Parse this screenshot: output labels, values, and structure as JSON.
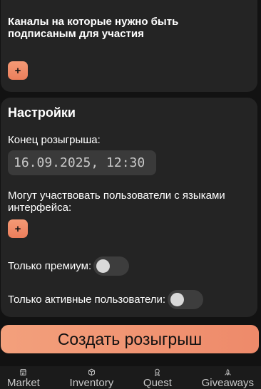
{
  "channels": {
    "title": "Каналы на которые нужно быть подписаным для участия",
    "add_label": "+"
  },
  "settings": {
    "title": "Настройки",
    "end_label": "Конец розыгрыша:",
    "end_value": "16.09.2025, 12:30",
    "lang_label": "Могут участвовать пользователи с языками интерфейса:",
    "lang_add_label": "+",
    "premium_label": "Только премиум:",
    "premium_on": false,
    "active_label": "Только активные пользователи:",
    "active_on": false
  },
  "create_button": "Создать розыгрыш",
  "tabbar": {
    "tabs": [
      {
        "label": "Market",
        "icon": "store-icon"
      },
      {
        "label": "Inventory",
        "icon": "box-icon"
      },
      {
        "label": "Quest",
        "icon": "medal-icon"
      },
      {
        "label": "Giveaways",
        "icon": "gift-icon"
      }
    ]
  },
  "colors": {
    "accent": "#ee8a6a",
    "card": "#242424",
    "background": "#121212"
  }
}
